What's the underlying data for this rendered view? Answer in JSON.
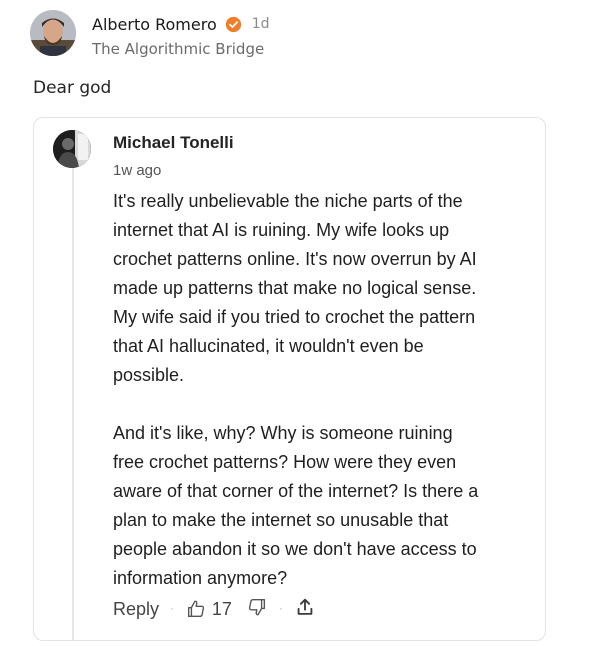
{
  "post": {
    "author": "Alberto Romero",
    "timestamp": "1d",
    "publication": "The Algorithmic Bridge",
    "text": "Dear god",
    "verified_color": "#f07d2c"
  },
  "quoted_reply": {
    "author": "Michael Tonelli",
    "timestamp": "1w ago",
    "lines": [
      "It's really unbelievable the niche parts of the",
      "internet that AI is ruining. My wife looks up",
      "crochet patterns online. It's now overrun by AI",
      "made up patterns that make no logical sense.",
      "My wife said if you tried to crochet the pattern",
      "that AI hallucinated, it wouldn't even be",
      "possible.",
      "",
      "And it's like, why? Why is someone ruining",
      "free crochet patterns? How were they even",
      "aware of that corner of the internet? Is there a",
      "plan to make the internet so unusable that",
      "people abandon it so we don't have access to",
      "information anymore?"
    ],
    "actions": {
      "reply_label": "Reply",
      "like_count": "17",
      "like_icon": "thumbs-up-icon",
      "dislike_icon": "thumbs-down-icon",
      "share_icon": "share-icon"
    }
  }
}
